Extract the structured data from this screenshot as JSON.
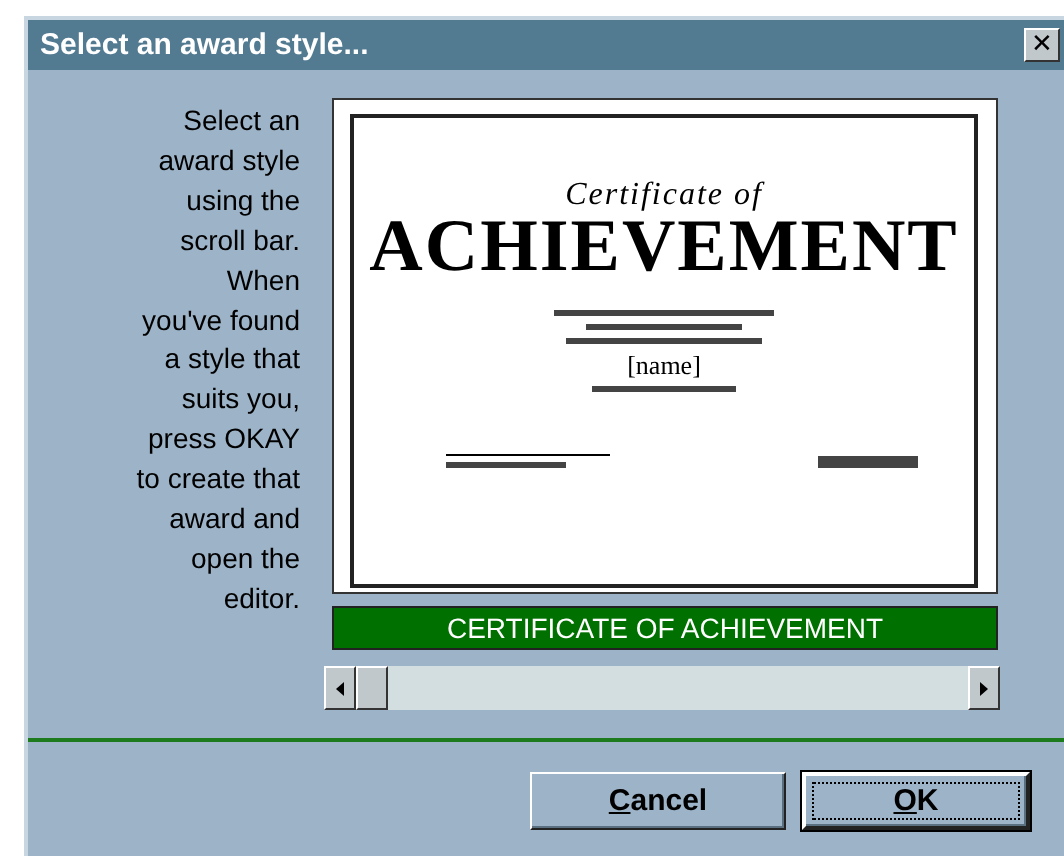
{
  "window": {
    "title": "Select an award style...",
    "close": "✕"
  },
  "instructions": "Select an\naward style\nusing the\nscroll bar.\nWhen\nyou've found\na style that\nsuits you,\npress OKAY\nto create that\naward and\nopen the\neditor.",
  "preview": {
    "heading": "Certificate of",
    "title": "ACHIEVEMENT",
    "name_field": "[name]",
    "caption": "CERTIFICATE OF ACHIEVEMENT"
  },
  "buttons": [
    {
      "label": "Cancel",
      "default": false
    },
    {
      "label": "OK",
      "default": true
    }
  ]
}
